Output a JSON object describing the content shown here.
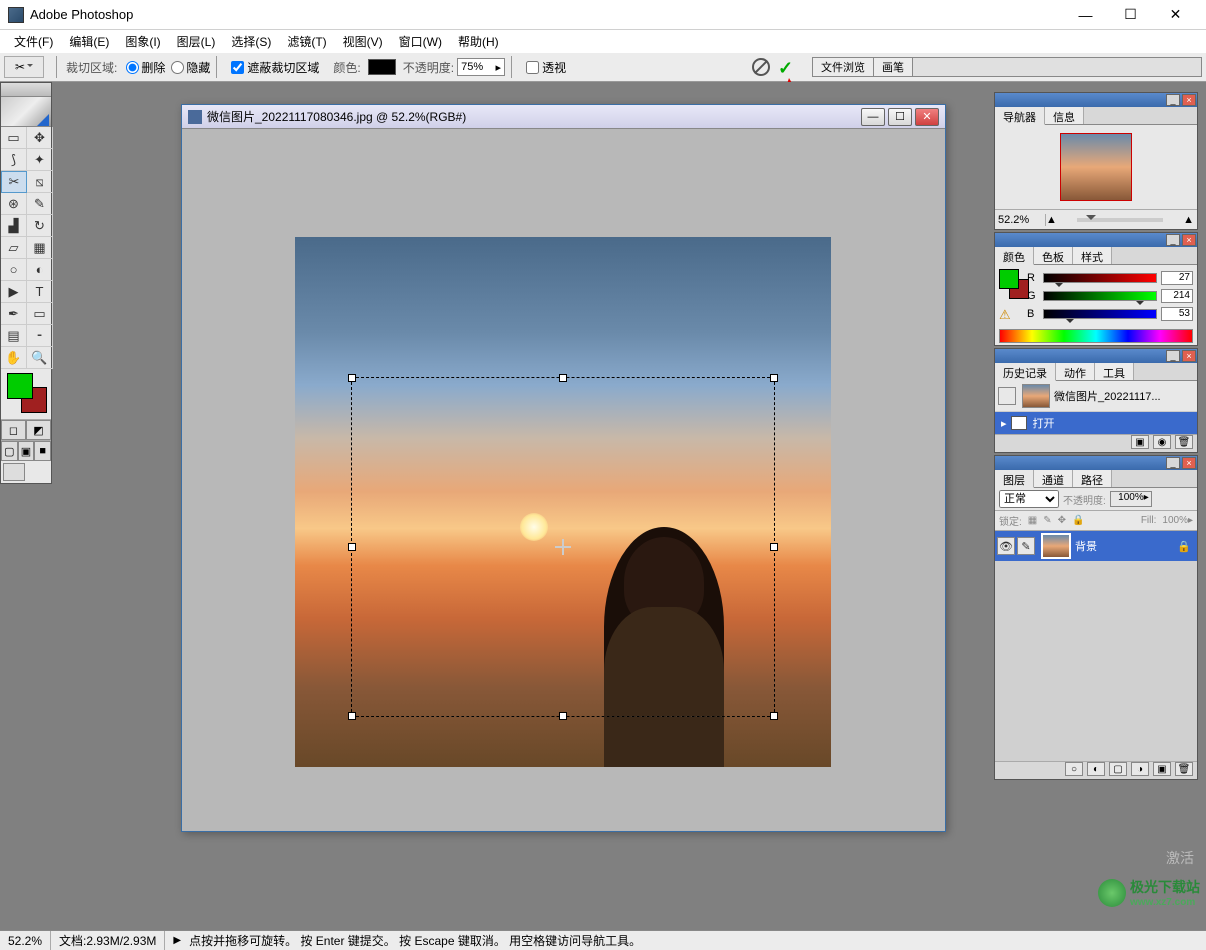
{
  "app": {
    "title": "Adobe Photoshop"
  },
  "menu": {
    "file": "文件(F)",
    "edit": "编辑(E)",
    "image": "图象(I)",
    "layer": "图层(L)",
    "select": "选择(S)",
    "filter": "滤镜(T)",
    "view": "视图(V)",
    "window": "窗口(W)",
    "help": "帮助(H)"
  },
  "options": {
    "crop_area": "裁切区域:",
    "delete": "删除",
    "hide": "隐藏",
    "shield": "遮蔽裁切区域",
    "color": "颜色:",
    "opacity": "不透明度:",
    "opacity_value": "75%",
    "perspective": "透视",
    "tab_browse": "文件浏览",
    "tab_brush": "画笔"
  },
  "document": {
    "title": "微信图片_20221117080346.jpg @ 52.2%(RGB#)"
  },
  "panels": {
    "nav": {
      "tab": "导航器",
      "info_tab": "信息",
      "zoom": "52.2%"
    },
    "color": {
      "tab": "颜色",
      "swatches_tab": "色板",
      "styles_tab": "样式",
      "r": "R",
      "g": "G",
      "b": "B",
      "r_val": "27",
      "g_val": "214",
      "b_val": "53"
    },
    "history": {
      "tab": "历史记录",
      "actions_tab": "动作",
      "tools_tab": "工具",
      "snapshot": "微信图片_20221117...",
      "step": "打开"
    },
    "layers": {
      "tab": "图层",
      "channels_tab": "通道",
      "paths_tab": "路径",
      "blend": "正常",
      "opacity_lbl": "不透明度:",
      "opacity_val": "100%",
      "lock_lbl": "锁定:",
      "fill_lbl": "Fill:",
      "fill_val": "100%",
      "layer_name": "背景"
    }
  },
  "status": {
    "zoom": "52.2%",
    "doc_size": "文档:2.93M/2.93M",
    "hint": "点按并拖移可旋转。 按 Enter 键提交。 按 Escape 键取消。 用空格键访问导航工具。"
  },
  "watermark": {
    "text": "极光下载站",
    "url": "www.xz7.com"
  },
  "hint": {
    "activate": "激活"
  }
}
